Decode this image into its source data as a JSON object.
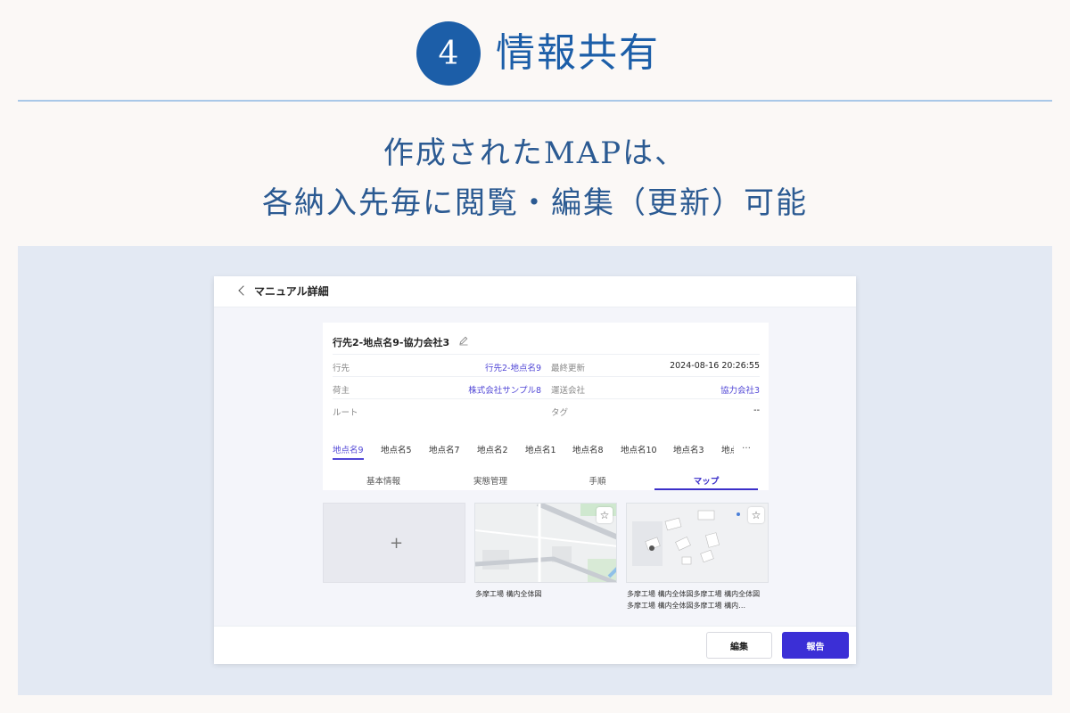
{
  "slide": {
    "step_number": "4",
    "step_title": "情報共有",
    "subtitle_line1": "作成されたMAPは、",
    "subtitle_line2": "各納入先毎に閲覧・編集（更新）可能",
    "accent_color": "#1c5ea8"
  },
  "window": {
    "title": "マニュアル詳細",
    "back_icon": "chevron-left-icon"
  },
  "manual": {
    "name": "行先2-地点名9-協力会社3",
    "edit_icon": "pencil-icon",
    "fields": {
      "destination_label": "行先",
      "destination_value": "行先2-地点名9",
      "last_updated_label": "最終更新",
      "last_updated_value": "2024-08-16 20:26:55",
      "shipper_label": "荷主",
      "shipper_value": "株式会社サンプル8",
      "carrier_label": "運送会社",
      "carrier_value": "協力会社3",
      "route_label": "ルート",
      "route_value": "",
      "tag_label": "タグ",
      "tag_value": "--"
    }
  },
  "point_tabs": [
    {
      "label": "地点名9",
      "active": true
    },
    {
      "label": "地点名5"
    },
    {
      "label": "地点名7"
    },
    {
      "label": "地点名2"
    },
    {
      "label": "地点名1"
    },
    {
      "label": "地点名8"
    },
    {
      "label": "地点名10"
    },
    {
      "label": "地点名3"
    },
    {
      "label": "地点名"
    }
  ],
  "more_icon": "…",
  "section_tabs": [
    {
      "label": "基本情報"
    },
    {
      "label": "実態管理"
    },
    {
      "label": "手順"
    },
    {
      "label": "マップ",
      "active": true
    }
  ],
  "maps": {
    "add_label": "+",
    "items": [
      {
        "caption": "多摩工場 構内全体図",
        "star_icon": "☆"
      },
      {
        "caption": "多摩工場 構内全体図多摩工場 構内全体図多摩工場 構内全体図多摩工場 構内…",
        "star_icon": "☆"
      }
    ]
  },
  "footer": {
    "edit_label": "編集",
    "report_label": "報告",
    "primary_color": "#3b2fd6"
  }
}
